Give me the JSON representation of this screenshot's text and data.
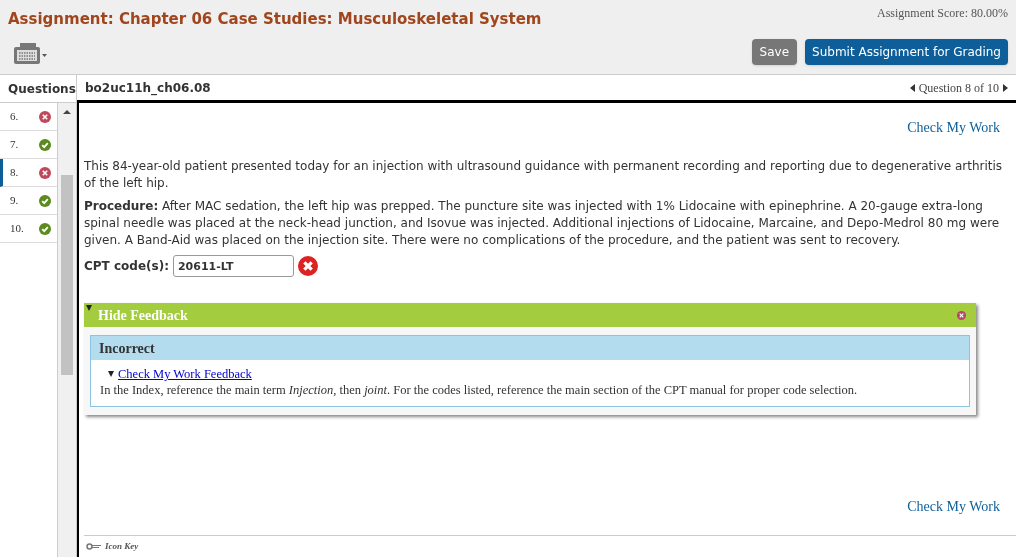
{
  "header": {
    "title": "Assignment: Chapter 06 Case Studies: Musculoskeletal System",
    "score": "Assignment Score: 80.00%",
    "save": "Save",
    "submit": "Submit Assignment for Grading"
  },
  "sidebar": {
    "title": "Questions",
    "items": [
      {
        "number": "6.",
        "correct": false,
        "selected": false
      },
      {
        "number": "7.",
        "correct": true,
        "selected": false
      },
      {
        "number": "8.",
        "correct": false,
        "selected": true
      },
      {
        "number": "9.",
        "correct": true,
        "selected": false
      },
      {
        "number": "10.",
        "correct": true,
        "selected": false
      }
    ]
  },
  "question_bar": {
    "id": "bo2uc11h_ch06.08",
    "nav": "Question 8 of 10"
  },
  "question": {
    "check_top": "Check My Work",
    "intro": "This 84-year-old patient presented today for an injection with ultrasound guidance with permanent recording and reporting due to degenerative arthritis of the left hip.",
    "procedure": "**Procedure:** After MAC sedation, the left hip was prepped. The puncture site was injected with 1% Lidocaine with epinephrine. A 20-gauge extra-long spinal needle was placed at the neck-head junction, and Isovue was injected. Additional injections of Lidocaine, Marcaine, and Depo-Medrol 80 mg were given. A Band-Aid was placed on the injection site. There were no complications of the procedure, and the patient was sent to recovery.",
    "field_label": "CPT code(s):",
    "field_value": "20611-LT",
    "correct": false,
    "check_bottom": "Check My Work"
  },
  "feedback": {
    "toggle": "Hide Feedback",
    "expanded": true,
    "verdict": "Incorrect",
    "link": "Check My Work Feedback",
    "text": "In the Index, reference the main term *Injection*, then *joint*. For the codes listed, reference the main section of the CPT manual for proper code selection."
  },
  "icon_key": "Icon Key"
}
